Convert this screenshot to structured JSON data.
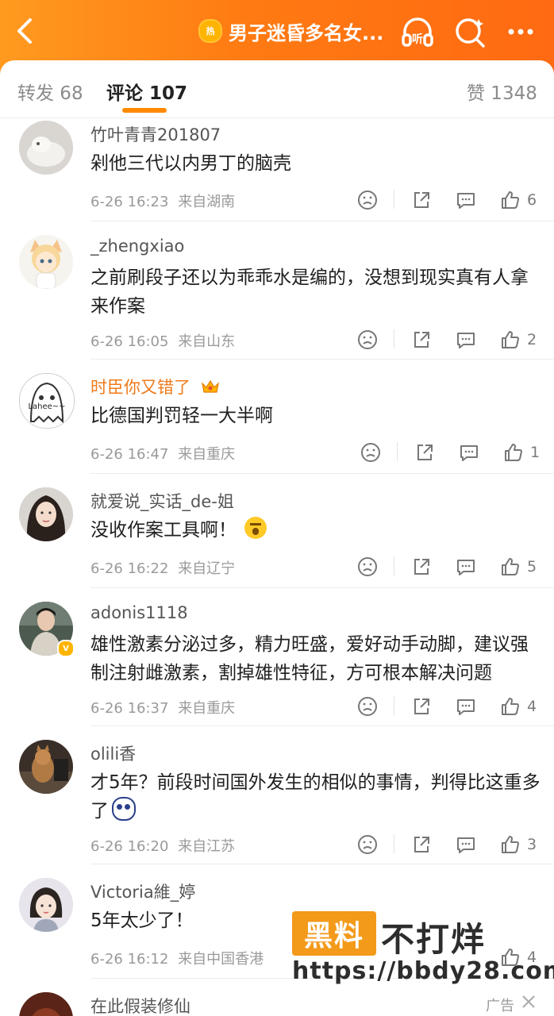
{
  "header": {
    "hot_badge": "热",
    "title": "男子迷昏多名女...",
    "listen_label": "听"
  },
  "tabs": {
    "repost": "转发 68",
    "comments": "评论 107",
    "likes": "赞 1348"
  },
  "colors": {
    "accent": "#ff8a00",
    "vip_name": "#f07a1a",
    "header_gradient": [
      "#ff9a1f",
      "#ff6a12"
    ]
  },
  "comments": [
    {
      "name": "竹叶青青201807",
      "text": "剁他三代以内男丁的脑壳",
      "time": "6-26 16:23",
      "source": "来自湖南",
      "likes": "6"
    },
    {
      "name": "_zhengxiao",
      "text": "之前刷段子还以为乖乖水是编的，没想到现实真有人拿来作案",
      "time": "6-26 16:05",
      "source": "来自山东",
      "likes": "2"
    },
    {
      "name": "时臣你又错了",
      "text": "比德国判罚轻一大半啊",
      "time": "6-26 16:47",
      "source": "来自重庆",
      "likes": "1",
      "avatar_text": "Lahee~~"
    },
    {
      "name": "就爱说_实话_de-姐",
      "text": "没收作案工具啊！",
      "time": "6-26 16:22",
      "source": "来自辽宁",
      "likes": "5"
    },
    {
      "name": "adonis1118",
      "text": "雄性激素分泌过多，精力旺盛，爱好动手动脚，建议强制注射雌激素，割掉雄性特征，方可根本解决问题",
      "time": "6-26 16:37",
      "source": "来自重庆",
      "likes": "4",
      "verified_badge": "V"
    },
    {
      "name": "olili香",
      "text": "才5年？前段时间国外发生的相似的事情，判得比这重多了",
      "time": "6-26 16:20",
      "source": "来自江苏",
      "likes": "3"
    },
    {
      "name": "Victoria維_婷",
      "text": "5年太少了！",
      "time": "6-26 16:12",
      "source": "来自中国香港",
      "likes": "4"
    },
    {
      "name": "在此假装修仙"
    }
  ],
  "watermark": {
    "box_text": "黑料",
    "text": "不打烊",
    "url": "https://bbdy28.com"
  },
  "ad": {
    "label": "广告"
  }
}
